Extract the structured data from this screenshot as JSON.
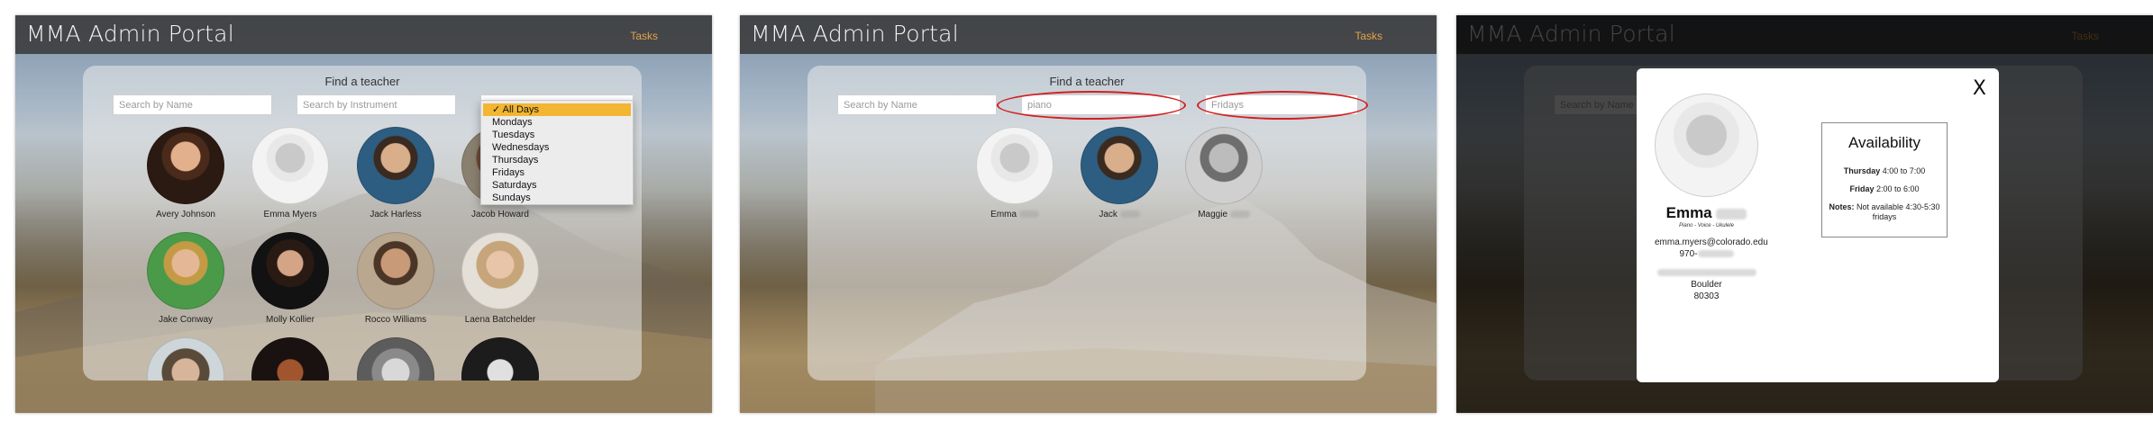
{
  "app_title": "MMA Admin Portal",
  "nav": {
    "tasks": "Tasks"
  },
  "finder": {
    "heading": "Find a teacher",
    "name_placeholder": "Search by Name",
    "instrument_placeholder": "Search by Instrument",
    "day_placeholder": "All Days"
  },
  "day_options": [
    "All Days",
    "Mondays",
    "Tuesdays",
    "Wednesdays",
    "Thursdays",
    "Fridays",
    "Saturdays",
    "Sundays"
  ],
  "selected_day_marker": "✓",
  "teachers": [
    {
      "name": "Avery Johnson"
    },
    {
      "name": "Emma Myers"
    },
    {
      "name": "Jack Harless"
    },
    {
      "name": "Jacob Howard"
    },
    {
      "name": "Jake Conway"
    },
    {
      "name": "Molly Kollier"
    },
    {
      "name": "Rocco Williams"
    },
    {
      "name": "Laena Batchelder"
    }
  ],
  "filtered": {
    "instrument_value": "piano",
    "day_value": "Fridays",
    "results": [
      {
        "first": "Emma"
      },
      {
        "first": "Jack"
      },
      {
        "first": "Maggie"
      }
    ]
  },
  "modal": {
    "close": "X",
    "first_name": "Emma",
    "instruments": "Piano - Voice - Ukulele",
    "email": "emma.myers@colorado.edu",
    "phone_prefix": "970-",
    "city": "Boulder",
    "zip": "80303",
    "availability_title": "Availability",
    "availability": [
      {
        "day": "Thursday",
        "time": "4:00 to 7:00"
      },
      {
        "day": "Friday",
        "time": "2:00 to 6:00"
      }
    ],
    "notes_label": "Notes:",
    "notes": "Not available 4:30-5:30 fridays"
  },
  "colors": {
    "accent": "#e8a24a",
    "highlight": "#f2b632",
    "annotation": "#d22020"
  }
}
